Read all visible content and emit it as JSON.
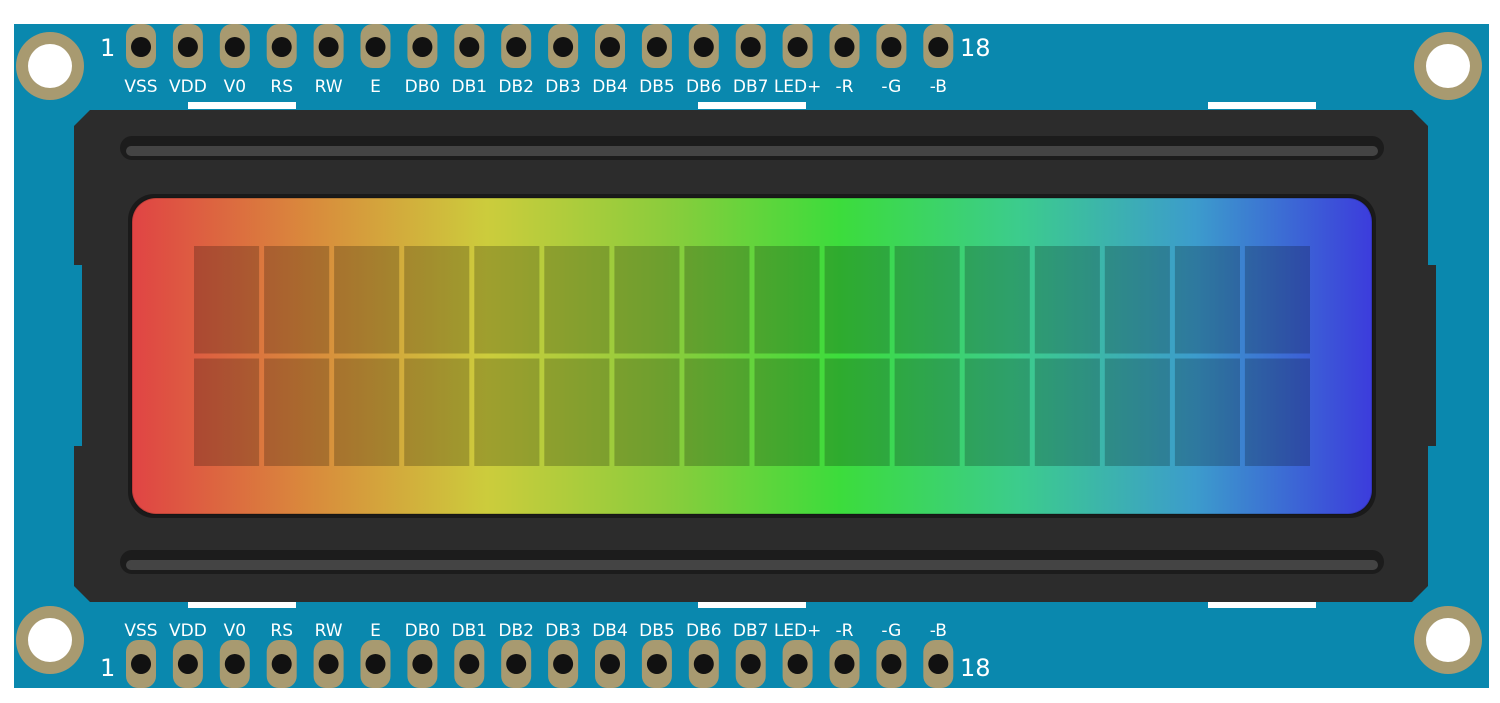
{
  "module": {
    "pins": {
      "labels": [
        "VSS",
        "VDD",
        "V0",
        "RS",
        "RW",
        "E",
        "DB0",
        "DB1",
        "DB2",
        "DB3",
        "DB4",
        "DB5",
        "DB6",
        "DB7",
        "LED+",
        "-R",
        "-G",
        "-B"
      ],
      "first_number": "1",
      "last_number": "18"
    },
    "display": {
      "columns": 16,
      "rows": 2
    },
    "colors": {
      "pcb": "#0a88ae",
      "pad": "#a89a70",
      "bezel": "#2c2c2c",
      "backlight_gradient": [
        "#e04444",
        "#d98a3c",
        "#cccc3c",
        "#8ccc3c",
        "#3cdc3c",
        "#3ccc8c",
        "#3c9ccc",
        "#3c3cdc"
      ]
    }
  }
}
